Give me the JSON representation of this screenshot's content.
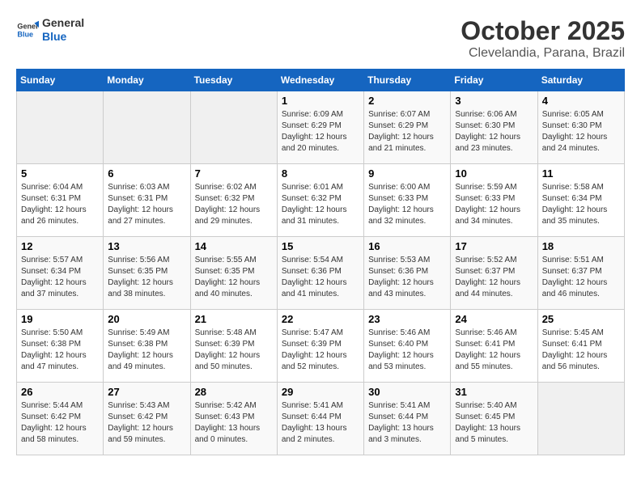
{
  "header": {
    "logo_line1": "General",
    "logo_line2": "Blue",
    "title": "October 2025",
    "subtitle": "Clevelandia, Parana, Brazil"
  },
  "calendar": {
    "weekdays": [
      "Sunday",
      "Monday",
      "Tuesday",
      "Wednesday",
      "Thursday",
      "Friday",
      "Saturday"
    ],
    "weeks": [
      [
        {
          "day": "",
          "info": ""
        },
        {
          "day": "",
          "info": ""
        },
        {
          "day": "",
          "info": ""
        },
        {
          "day": "1",
          "info": "Sunrise: 6:09 AM\nSunset: 6:29 PM\nDaylight: 12 hours\nand 20 minutes."
        },
        {
          "day": "2",
          "info": "Sunrise: 6:07 AM\nSunset: 6:29 PM\nDaylight: 12 hours\nand 21 minutes."
        },
        {
          "day": "3",
          "info": "Sunrise: 6:06 AM\nSunset: 6:30 PM\nDaylight: 12 hours\nand 23 minutes."
        },
        {
          "day": "4",
          "info": "Sunrise: 6:05 AM\nSunset: 6:30 PM\nDaylight: 12 hours\nand 24 minutes."
        }
      ],
      [
        {
          "day": "5",
          "info": "Sunrise: 6:04 AM\nSunset: 6:31 PM\nDaylight: 12 hours\nand 26 minutes."
        },
        {
          "day": "6",
          "info": "Sunrise: 6:03 AM\nSunset: 6:31 PM\nDaylight: 12 hours\nand 27 minutes."
        },
        {
          "day": "7",
          "info": "Sunrise: 6:02 AM\nSunset: 6:32 PM\nDaylight: 12 hours\nand 29 minutes."
        },
        {
          "day": "8",
          "info": "Sunrise: 6:01 AM\nSunset: 6:32 PM\nDaylight: 12 hours\nand 31 minutes."
        },
        {
          "day": "9",
          "info": "Sunrise: 6:00 AM\nSunset: 6:33 PM\nDaylight: 12 hours\nand 32 minutes."
        },
        {
          "day": "10",
          "info": "Sunrise: 5:59 AM\nSunset: 6:33 PM\nDaylight: 12 hours\nand 34 minutes."
        },
        {
          "day": "11",
          "info": "Sunrise: 5:58 AM\nSunset: 6:34 PM\nDaylight: 12 hours\nand 35 minutes."
        }
      ],
      [
        {
          "day": "12",
          "info": "Sunrise: 5:57 AM\nSunset: 6:34 PM\nDaylight: 12 hours\nand 37 minutes."
        },
        {
          "day": "13",
          "info": "Sunrise: 5:56 AM\nSunset: 6:35 PM\nDaylight: 12 hours\nand 38 minutes."
        },
        {
          "day": "14",
          "info": "Sunrise: 5:55 AM\nSunset: 6:35 PM\nDaylight: 12 hours\nand 40 minutes."
        },
        {
          "day": "15",
          "info": "Sunrise: 5:54 AM\nSunset: 6:36 PM\nDaylight: 12 hours\nand 41 minutes."
        },
        {
          "day": "16",
          "info": "Sunrise: 5:53 AM\nSunset: 6:36 PM\nDaylight: 12 hours\nand 43 minutes."
        },
        {
          "day": "17",
          "info": "Sunrise: 5:52 AM\nSunset: 6:37 PM\nDaylight: 12 hours\nand 44 minutes."
        },
        {
          "day": "18",
          "info": "Sunrise: 5:51 AM\nSunset: 6:37 PM\nDaylight: 12 hours\nand 46 minutes."
        }
      ],
      [
        {
          "day": "19",
          "info": "Sunrise: 5:50 AM\nSunset: 6:38 PM\nDaylight: 12 hours\nand 47 minutes."
        },
        {
          "day": "20",
          "info": "Sunrise: 5:49 AM\nSunset: 6:38 PM\nDaylight: 12 hours\nand 49 minutes."
        },
        {
          "day": "21",
          "info": "Sunrise: 5:48 AM\nSunset: 6:39 PM\nDaylight: 12 hours\nand 50 minutes."
        },
        {
          "day": "22",
          "info": "Sunrise: 5:47 AM\nSunset: 6:39 PM\nDaylight: 12 hours\nand 52 minutes."
        },
        {
          "day": "23",
          "info": "Sunrise: 5:46 AM\nSunset: 6:40 PM\nDaylight: 12 hours\nand 53 minutes."
        },
        {
          "day": "24",
          "info": "Sunrise: 5:46 AM\nSunset: 6:41 PM\nDaylight: 12 hours\nand 55 minutes."
        },
        {
          "day": "25",
          "info": "Sunrise: 5:45 AM\nSunset: 6:41 PM\nDaylight: 12 hours\nand 56 minutes."
        }
      ],
      [
        {
          "day": "26",
          "info": "Sunrise: 5:44 AM\nSunset: 6:42 PM\nDaylight: 12 hours\nand 58 minutes."
        },
        {
          "day": "27",
          "info": "Sunrise: 5:43 AM\nSunset: 6:42 PM\nDaylight: 12 hours\nand 59 minutes."
        },
        {
          "day": "28",
          "info": "Sunrise: 5:42 AM\nSunset: 6:43 PM\nDaylight: 13 hours\nand 0 minutes."
        },
        {
          "day": "29",
          "info": "Sunrise: 5:41 AM\nSunset: 6:44 PM\nDaylight: 13 hours\nand 2 minutes."
        },
        {
          "day": "30",
          "info": "Sunrise: 5:41 AM\nSunset: 6:44 PM\nDaylight: 13 hours\nand 3 minutes."
        },
        {
          "day": "31",
          "info": "Sunrise: 5:40 AM\nSunset: 6:45 PM\nDaylight: 13 hours\nand 5 minutes."
        },
        {
          "day": "",
          "info": ""
        }
      ]
    ]
  }
}
